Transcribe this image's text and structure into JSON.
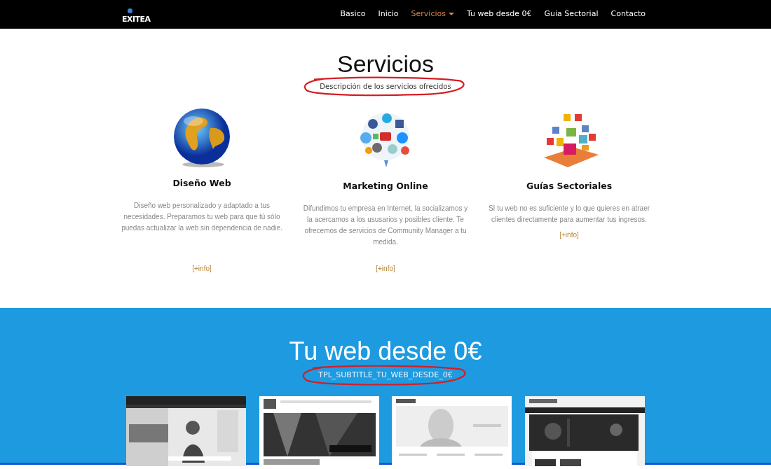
{
  "navbar": {
    "logo": "EXITEA",
    "items": [
      {
        "label": "Basico",
        "selected": false,
        "dropdown": false
      },
      {
        "label": "Inicio",
        "selected": false,
        "dropdown": false
      },
      {
        "label": "Servicios",
        "selected": true,
        "dropdown": true
      },
      {
        "label": "Tu web desde 0€",
        "selected": false,
        "dropdown": false
      },
      {
        "label": "Guia Sectorial",
        "selected": false,
        "dropdown": false
      },
      {
        "label": "Contacto",
        "selected": false,
        "dropdown": false
      }
    ]
  },
  "services": {
    "title": "Servicios",
    "subtitle": "Descripción de los servicios ofrecidos",
    "circled": true,
    "items": [
      {
        "kind": "globe",
        "title": "Diseño Web",
        "text": "Diseño web personalizado  y adaptado a tus necesidades. Preparamos tu web para que tú sólo puedas actualizar la web sin dependencia de nadie.",
        "link": "[+info]"
      },
      {
        "kind": "social",
        "title": "Marketing Online",
        "text": "Difundimos tu empresa en Internet, la socializamos y la acercamos a los ususarios y posibles cliente. Te ofrecemos de servicios de Community Manager a tu medida.",
        "link": "[+info]"
      },
      {
        "kind": "guides",
        "title": "Guías Sectoriales",
        "text": "SI tu web no es suficiente y lo que quieres en atraer clientes directamente para aumentar tus ingresos.",
        "link": "[+info]"
      }
    ]
  },
  "web_section": {
    "title": "Tu web desde 0€",
    "subtitle": "TPL_SUBTITLE_TU_WEB_DESDE_0€",
    "circled": true
  }
}
